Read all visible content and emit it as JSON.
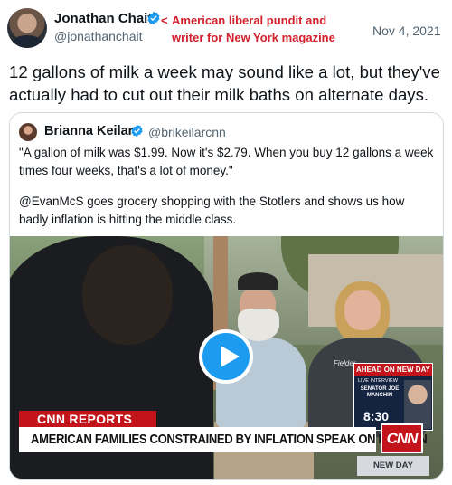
{
  "tweet": {
    "author_name": "Jonathan Chait",
    "author_handle": "@jonathanchait",
    "annotation": "American liberal pundit and writer for New York magazine",
    "annotation_arrow": "<",
    "date": "Nov 4, 2021",
    "text": "12 gallons of milk a week may sound like a lot, but they've actually had to cut out their milk baths on alternate days."
  },
  "quoted_tweet": {
    "author_name": "Brianna Keilar",
    "author_handle": "@brikeilarcnn",
    "paragraph_1": "\"A gallon of milk was $1.99. Now it's $2.79. When you buy 12 gallons a week times four weeks, that's a lot of money.\"",
    "paragraph_2": "@EvanMcS goes grocery shopping with the Stotlers and shows us how badly inflation is hitting the middle class."
  },
  "video": {
    "shirt_logo": "Fielder",
    "ahead_header": "AHEAD ON NEW DAY",
    "ahead_sub": "LIVE INTERVIEW",
    "ahead_guest": "SENATOR JOE MANCHIN",
    "ahead_time": "8:30",
    "cnn_reports": "CNN REPORTS",
    "chyron": "AMERICAN FAMILIES CONSTRAINED BY INFLATION SPEAK ON BURDEN",
    "network_logo": "CNN",
    "show_bug": "NEW DAY"
  },
  "colors": {
    "verified": "#1d9bf0",
    "annotation": "#d2222d",
    "cnn_red": "#c2141a",
    "play_button": "#1d9bf0"
  },
  "icons": {
    "verified": "verified-badge-icon",
    "play": "play-icon"
  }
}
